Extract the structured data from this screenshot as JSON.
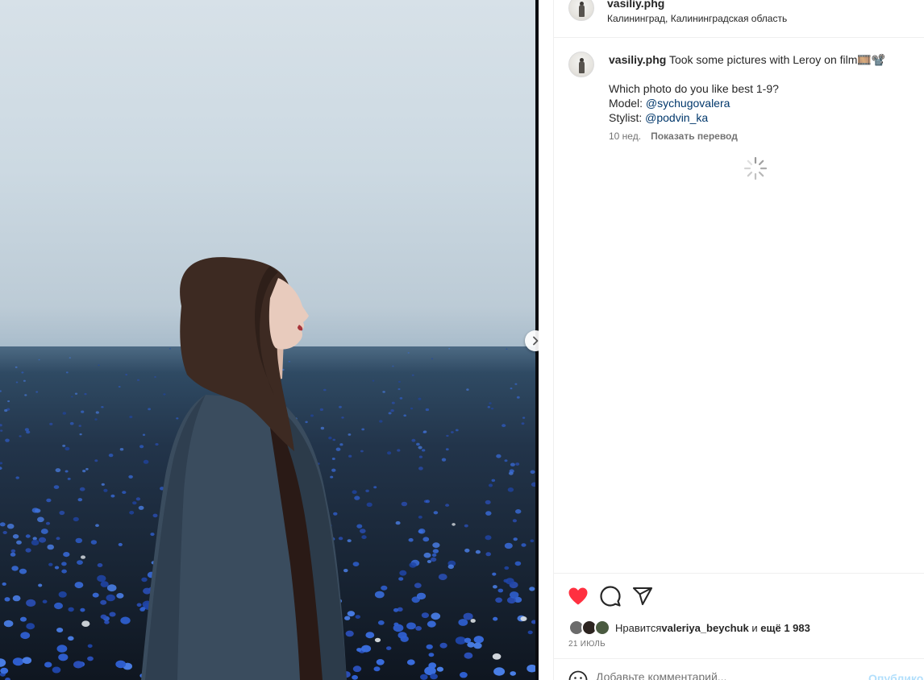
{
  "post": {
    "username": "vasiliy.phg",
    "location": "Калининград, Калининградская область",
    "caption": {
      "username": "vasiliy.phg",
      "line1": "Took some pictures with Leroy on film",
      "line1_emoji": "🎞️📽️",
      "question": "Which photo do you like best 1-9?",
      "model_label": "Model: ",
      "model_handle": "@sychugovalera",
      "stylist_label": "Stylist: ",
      "stylist_handle": "@podvin_ka"
    },
    "time_ago": "10 нед.",
    "translate_label": "Показать перевод"
  },
  "likes": {
    "prefix": "Нравится ",
    "user": "valeriya_beychuk",
    "middle": " и ",
    "more": "ещё 1 983"
  },
  "date": "21 ИЮЛЬ",
  "comment": {
    "placeholder": "Добавьте комментарий...",
    "post_label": "Опубликовать"
  },
  "icons": {
    "like": "heart-icon",
    "comment": "comment-icon",
    "share": "share-icon",
    "emoji": "emoji-icon",
    "next": "chevron-right-icon"
  },
  "colors": {
    "like_red": "#ff3040",
    "link": "#00376b",
    "muted": "#737373",
    "post_disabled": "#b2dffc"
  }
}
